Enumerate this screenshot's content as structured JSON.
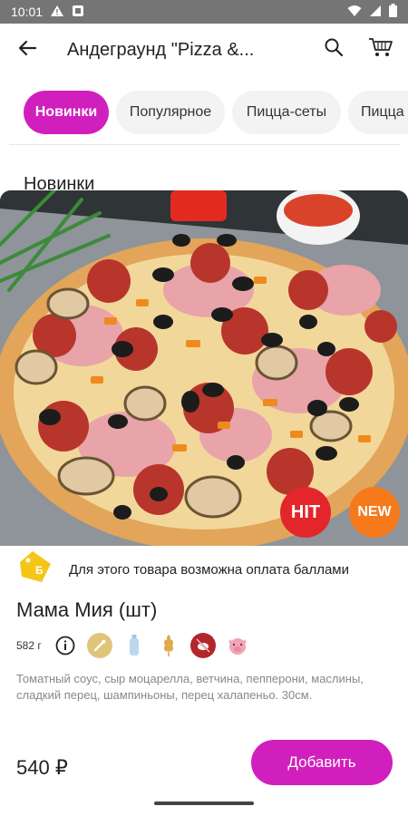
{
  "status_bar": {
    "time": "10:01"
  },
  "app_bar": {
    "title": "Андеграунд \"Pizza &..."
  },
  "categories": [
    "Новинки",
    "Популярное",
    "Пицца-сеты",
    "Пицца"
  ],
  "section_title": "Новинки",
  "product": {
    "badges": [
      "HIT",
      "NEW"
    ],
    "points_note": "Для этого товара возможна оплата баллами",
    "name": "Мама Мия (шт)",
    "weight": "582 г",
    "description": "Томатный соус, сыр моцарелла, ветчина, пепперони, маслины, сладкий перец, шампиньоны, перец халапеньо. 30см.",
    "price": "540 ₽",
    "add_label": "Добавить"
  },
  "colors": {
    "accent": "#d11fbd",
    "hit": "#e3262b",
    "new": "#f47a1c",
    "points_tag": "#f5c518"
  },
  "icons": [
    "back-arrow-icon",
    "search-icon",
    "cart-icon",
    "points-tag-icon",
    "info-icon",
    "spicy-icon",
    "bottle-icon",
    "wheat-icon",
    "no-meat-icon",
    "pig-icon"
  ]
}
